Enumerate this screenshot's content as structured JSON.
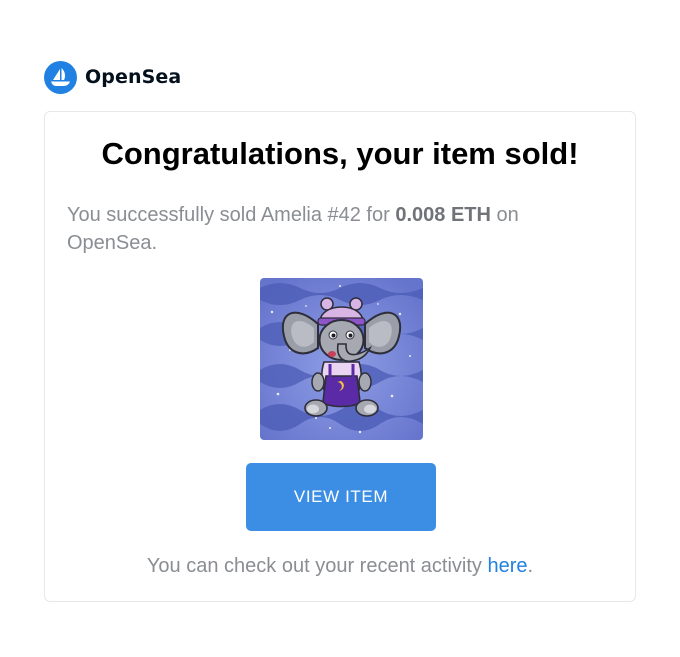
{
  "brand": {
    "name": "OpenSea",
    "logo_icon": "opensea-sailboat-icon",
    "color": "#2081e2"
  },
  "email": {
    "title": "Congratulations, your item sold!",
    "message_prefix": "You successfully sold Amelia #42 for ",
    "price": "0.008 ETH",
    "message_suffix": " on OpenSea.",
    "item_image": "elephant-nft-image",
    "button_label": "VIEW ITEM",
    "button_color": "#3b8ee4",
    "footer_prefix": "You can check out your recent activity ",
    "footer_link": "here",
    "footer_suffix": "."
  }
}
